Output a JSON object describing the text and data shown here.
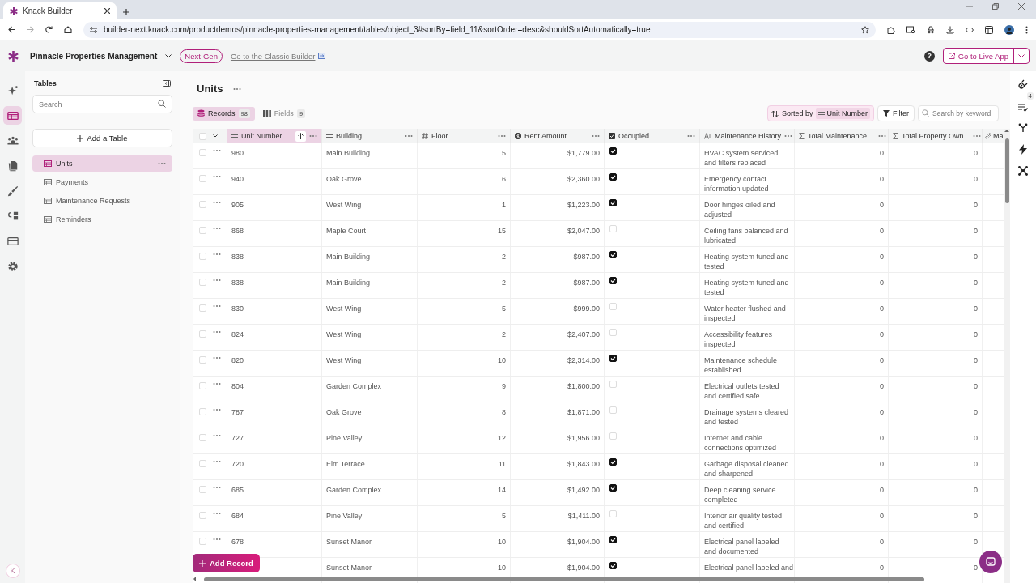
{
  "browser": {
    "tab_title": "Knack Builder",
    "url": "builder-next.knack.com/productdemos/pinnacle-properties-management/tables/object_3#sortBy=field_11&sortOrder=desc&shouldSortAutomatically=true"
  },
  "header": {
    "app_name": "Pinnacle Properties Management",
    "badge": "Next-Gen",
    "classic_link": "Go to the Classic Builder",
    "help": "?",
    "live_button": "Go to Live App"
  },
  "rail": {
    "items": [
      {
        "kind": "sparkle",
        "selected": false
      },
      {
        "kind": "table",
        "selected": true
      },
      {
        "kind": "people",
        "selected": false
      },
      {
        "kind": "docs",
        "selected": false
      },
      {
        "kind": "brush",
        "selected": false
      },
      {
        "kind": "flow",
        "selected": false
      },
      {
        "kind": "card",
        "selected": false
      },
      {
        "kind": "gear",
        "selected": false
      }
    ],
    "avatar": "K"
  },
  "sidebar": {
    "title": "Tables",
    "search_placeholder": "Search",
    "add_button": "Add a Table",
    "items": [
      {
        "label": "Units",
        "selected": true
      },
      {
        "label": "Payments",
        "selected": false
      },
      {
        "label": "Maintenance Requests",
        "selected": false
      },
      {
        "label": "Reminders",
        "selected": false
      }
    ]
  },
  "page": {
    "title": "Units",
    "tabs": [
      {
        "label": "Records",
        "count": "98",
        "selected": true
      },
      {
        "label": "Fields",
        "count": "9",
        "selected": false
      }
    ],
    "sorted_label": "Sorted by",
    "sorted_field": "Unit Number",
    "filter": "Filter",
    "search_placeholder": "Search by keyword",
    "add_record": "Add Record"
  },
  "table": {
    "all_selected": false,
    "columns": [
      {
        "label": "Unit Number",
        "kind": "text",
        "sorted": true
      },
      {
        "label": "Building",
        "kind": "text",
        "sorted": false
      },
      {
        "label": "Floor",
        "kind": "number",
        "sorted": false
      },
      {
        "label": "Rent Amount",
        "kind": "currency",
        "sorted": false
      },
      {
        "label": "Occupied",
        "kind": "boolean",
        "sorted": false
      },
      {
        "label": "Maintenance History",
        "kind": "paragraph",
        "sorted": false
      },
      {
        "label": "Total Maintenance ...",
        "kind": "sum",
        "sorted": false
      },
      {
        "label": "Total Property Own...",
        "kind": "sum",
        "sorted": false
      },
      {
        "label": "Ma",
        "kind": "link",
        "sorted": false
      }
    ],
    "rows": [
      {
        "selected": false,
        "unit": "980",
        "building": "Main Building",
        "floor": "5",
        "rent": "$1,779.00",
        "occupied": true,
        "history": "HVAC system serviced and filters replaced",
        "total_maintenance": "0",
        "total_property": "0"
      },
      {
        "selected": false,
        "unit": "940",
        "building": "Oak Grove",
        "floor": "6",
        "rent": "$2,360.00",
        "occupied": true,
        "history": "Emergency contact information updated",
        "total_maintenance": "0",
        "total_property": "0"
      },
      {
        "selected": false,
        "unit": "905",
        "building": "West Wing",
        "floor": "1",
        "rent": "$1,223.00",
        "occupied": true,
        "history": "Door hinges oiled and adjusted",
        "total_maintenance": "0",
        "total_property": "0"
      },
      {
        "selected": false,
        "unit": "868",
        "building": "Maple Court",
        "floor": "15",
        "rent": "$2,047.00",
        "occupied": false,
        "history": "Ceiling fans balanced and lubricated",
        "total_maintenance": "0",
        "total_property": "0"
      },
      {
        "selected": false,
        "unit": "838",
        "building": "Main Building",
        "floor": "2",
        "rent": "$987.00",
        "occupied": true,
        "history": "Heating system tuned and tested",
        "total_maintenance": "0",
        "total_property": "0"
      },
      {
        "selected": false,
        "unit": "838",
        "building": "Main Building",
        "floor": "2",
        "rent": "$987.00",
        "occupied": true,
        "history": "Heating system tuned and tested",
        "total_maintenance": "0",
        "total_property": "0"
      },
      {
        "selected": false,
        "unit": "830",
        "building": "West Wing",
        "floor": "5",
        "rent": "$999.00",
        "occupied": false,
        "history": "Water heater flushed and inspected",
        "total_maintenance": "0",
        "total_property": "0"
      },
      {
        "selected": false,
        "unit": "824",
        "building": "West Wing",
        "floor": "2",
        "rent": "$2,407.00",
        "occupied": false,
        "history": "Accessibility features inspected",
        "total_maintenance": "0",
        "total_property": "0"
      },
      {
        "selected": false,
        "unit": "820",
        "building": "West Wing",
        "floor": "10",
        "rent": "$2,314.00",
        "occupied": true,
        "history": "Maintenance schedule established",
        "total_maintenance": "0",
        "total_property": "0"
      },
      {
        "selected": false,
        "unit": "804",
        "building": "Garden Complex",
        "floor": "9",
        "rent": "$1,800.00",
        "occupied": false,
        "history": "Electrical outlets tested and certified safe",
        "total_maintenance": "0",
        "total_property": "0"
      },
      {
        "selected": false,
        "unit": "787",
        "building": "Oak Grove",
        "floor": "8",
        "rent": "$1,871.00",
        "occupied": false,
        "history": "Drainage systems cleared and tested",
        "total_maintenance": "0",
        "total_property": "0"
      },
      {
        "selected": false,
        "unit": "727",
        "building": "Pine Valley",
        "floor": "12",
        "rent": "$1,956.00",
        "occupied": false,
        "history": "Internet and cable connections optimized",
        "total_maintenance": "0",
        "total_property": "0"
      },
      {
        "selected": false,
        "unit": "720",
        "building": "Elm Terrace",
        "floor": "11",
        "rent": "$1,843.00",
        "occupied": true,
        "history": "Garbage disposal cleaned and sharpened",
        "total_maintenance": "0",
        "total_property": "0"
      },
      {
        "selected": false,
        "unit": "685",
        "building": "Garden Complex",
        "floor": "14",
        "rent": "$1,492.00",
        "occupied": true,
        "history": "Deep cleaning service completed",
        "total_maintenance": "0",
        "total_property": "0"
      },
      {
        "selected": false,
        "unit": "684",
        "building": "Pine Valley",
        "floor": "5",
        "rent": "$1,411.00",
        "occupied": false,
        "history": "Interior air quality tested and certified",
        "total_maintenance": "0",
        "total_property": "0"
      },
      {
        "selected": false,
        "unit": "678",
        "building": "Sunset Manor",
        "floor": "10",
        "rent": "$1,904.00",
        "occupied": true,
        "history": "Electrical panel labeled and documented",
        "total_maintenance": "0",
        "total_property": "0"
      },
      {
        "building": "Sunset Manor",
        "floor": "10",
        "rent": "$1,904.00",
        "occupied": true,
        "history": "Electrical panel labeled and",
        "total_maintenance": "0",
        "total_property": "0"
      }
    ]
  },
  "right_rail": {
    "badge": "4"
  }
}
